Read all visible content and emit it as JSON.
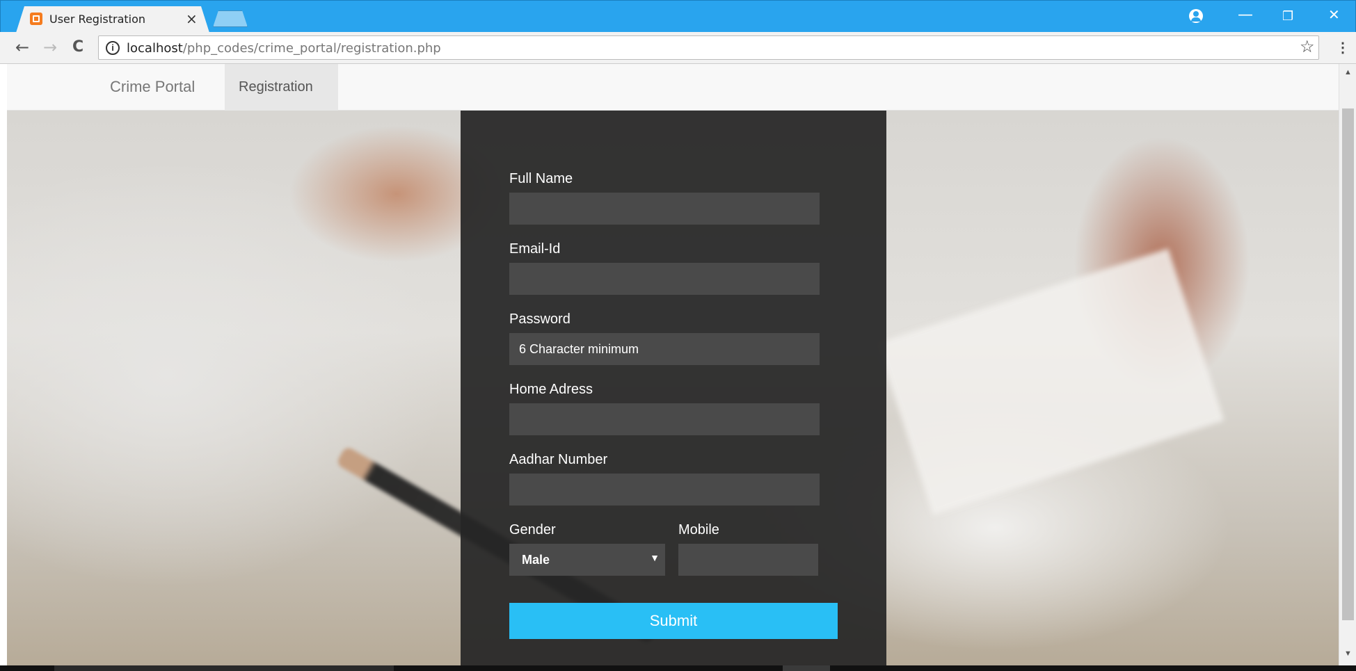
{
  "browser": {
    "tab_title": "User Registration",
    "tab_close": "×",
    "url_host": "localhost",
    "url_path": "/php_codes/crime_portal/registration.php",
    "back": "←",
    "forward": "→",
    "reload": "C",
    "info": "i",
    "bookmark": "☆",
    "menu": "⋮",
    "minimize": "—",
    "restore": "❐",
    "close": "✕"
  },
  "navbar": {
    "brand": "Crime Portal",
    "active_item": "Registration"
  },
  "form": {
    "full_name_label": "Full Name",
    "email_label": "Email-Id",
    "password_label": "Password",
    "password_placeholder": "6 Character minimum",
    "address_label": "Home Adress",
    "aadhar_label": "Aadhar Number",
    "gender_label": "Gender",
    "gender_value": "Male",
    "gender_arrow": "▼",
    "mobile_label": "Mobile",
    "submit_label": "Submit"
  },
  "scroll": {
    "up": "▲",
    "down": "▼"
  },
  "colors": {
    "titlebar": "#29a4ee",
    "panel": "#262626",
    "field": "#4a4a4a",
    "submit": "#29bff5"
  }
}
